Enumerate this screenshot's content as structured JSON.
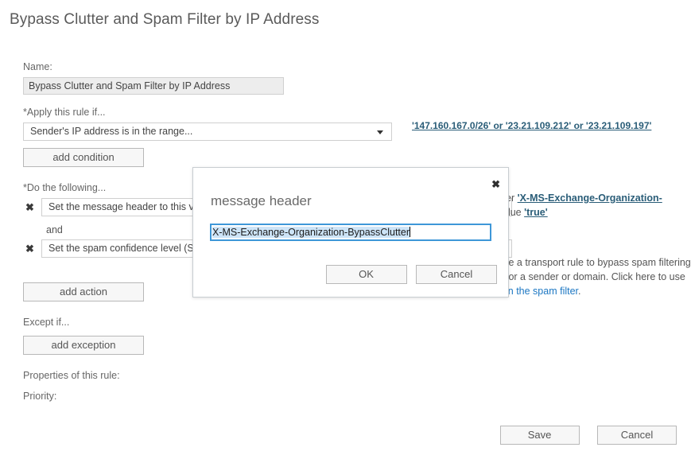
{
  "page": {
    "title": "Bypass Clutter and Spam Filter by IP Address"
  },
  "form": {
    "name_label": "Name:",
    "name_value": "Bypass Clutter and Spam Filter by IP Address",
    "apply_label": "*Apply this rule if...",
    "condition_value": "Sender's IP address is in the range...",
    "condition_link": "'147.160.167.0/26' or '23.21.109.212' or '23.21.109.197'",
    "add_condition_label": "add condition",
    "do_following_label": "*Do the following...",
    "action1_value": "Set the message header to this value...",
    "action1_remove": "✖",
    "and_label": "and",
    "action2_value": "Set the spam confidence level (SCL) to...",
    "action2_remove": "✖",
    "add_action_label": "add action",
    "except_label": "Except if...",
    "add_exception_label": "add exception",
    "properties_label": "Properties of this rule:",
    "priority_label": "Priority:"
  },
  "side": {
    "action1_prefix": "er",
    "action1_link": "'X-MS-Exchange-Organization-",
    "action1_line2_prefix": "alue",
    "action1_line2_link": "'true'",
    "help_line1": "te a transport rule to bypass spam filtering",
    "help_line2": "for a sender or domain. Click here to use",
    "help_line3_link": "in the spam filter",
    "help_line3_suffix": "."
  },
  "dialog": {
    "title": "message header",
    "close_icon": "✖",
    "input_selected_text": "X-MS-Exchange-Organization-BypassClutter",
    "ok_label": "OK",
    "cancel_label": "Cancel"
  },
  "footer": {
    "save_label": "Save",
    "cancel_label": "Cancel"
  },
  "colors": {
    "accent_link": "#2a5d78",
    "plain_link": "#1c77c3",
    "focus_border": "#3e97d8",
    "selection": "#cde4f7"
  }
}
